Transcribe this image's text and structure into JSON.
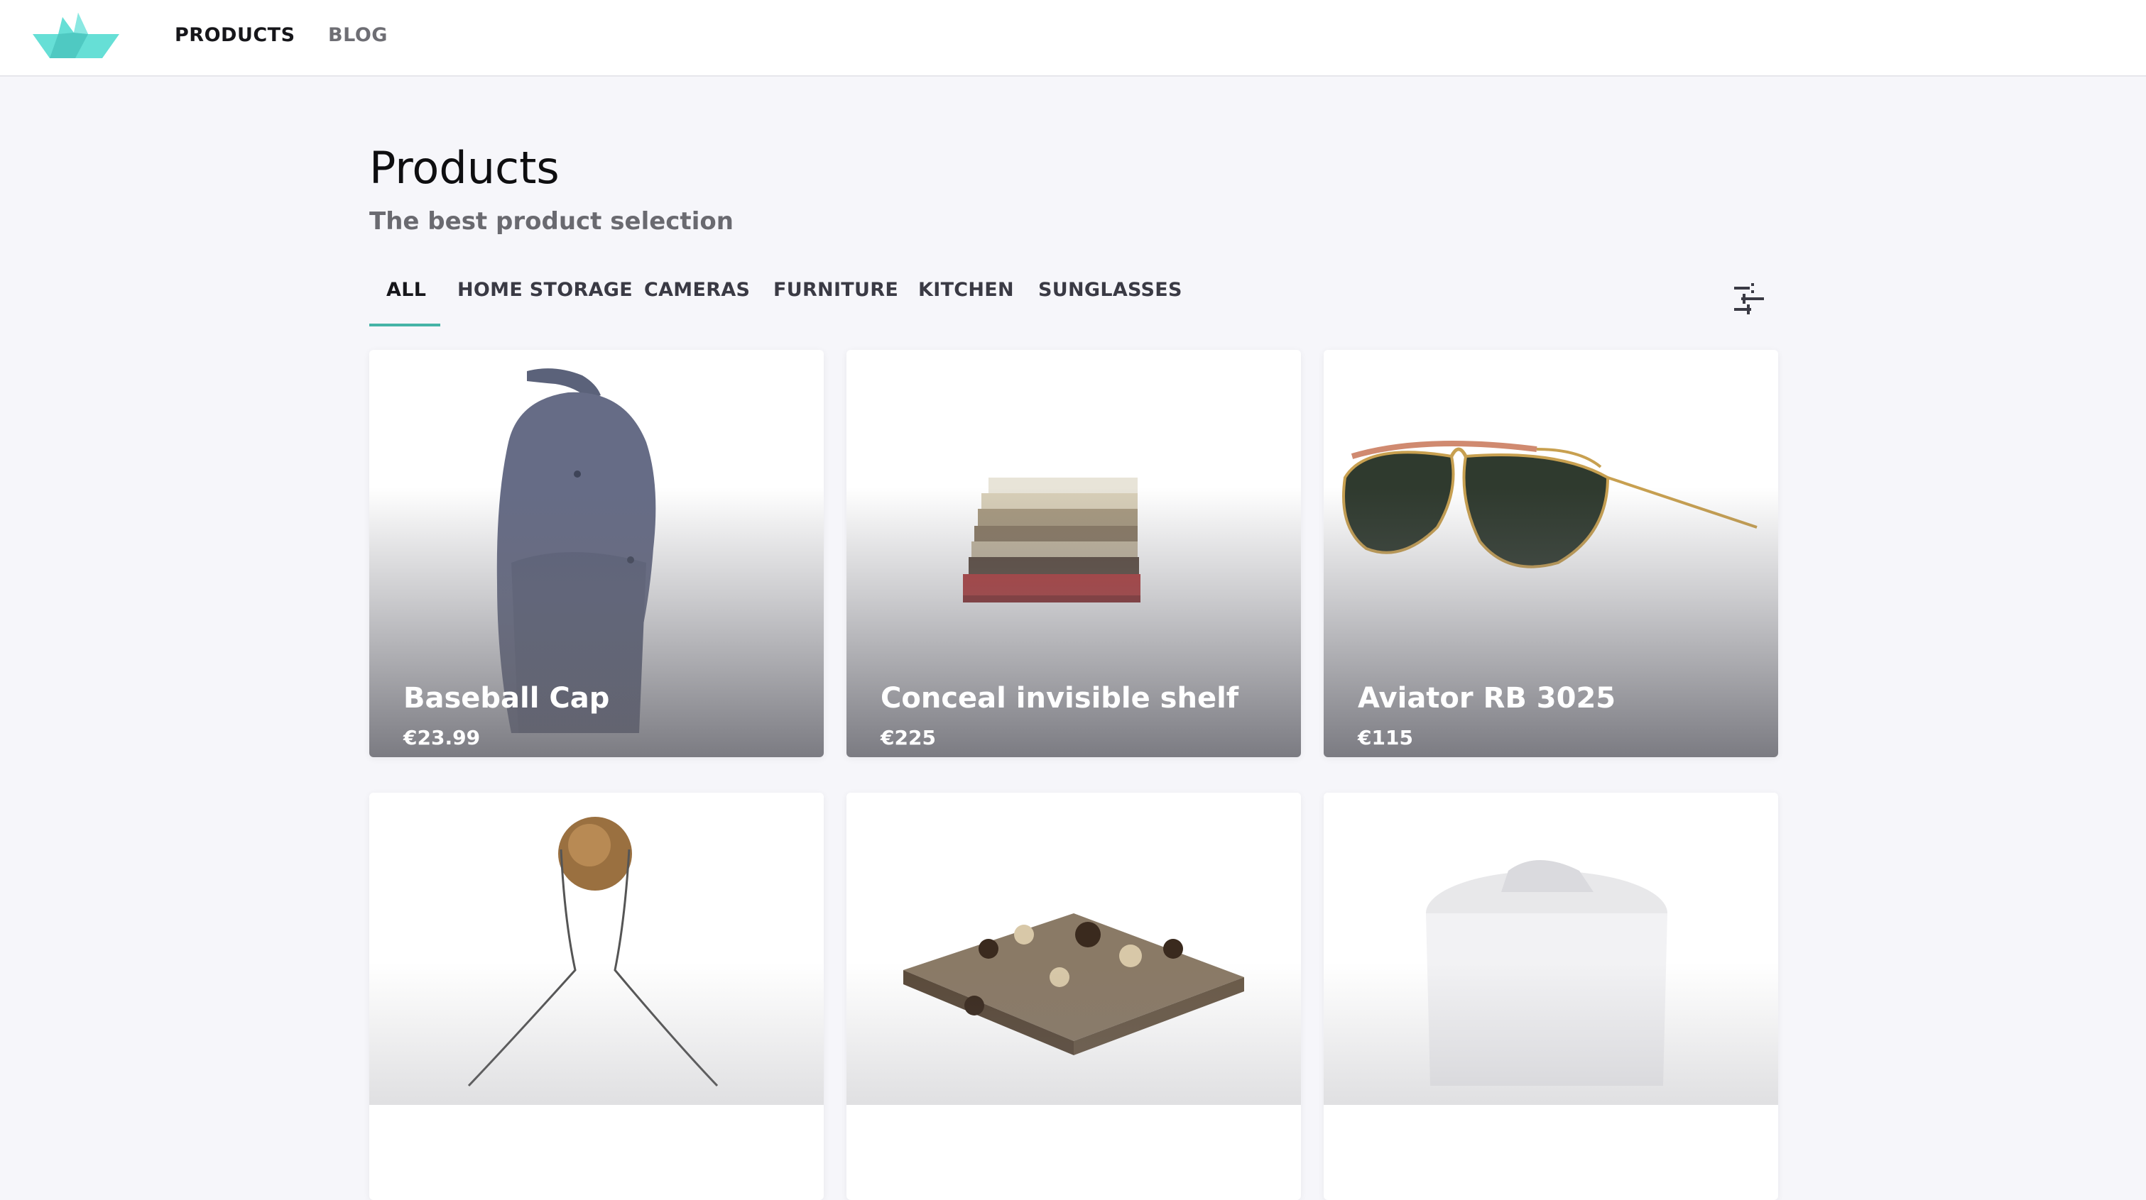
{
  "header": {
    "logo_icon": "paper-boat-icon",
    "nav": [
      {
        "label": "PRODUCTS",
        "active": true
      },
      {
        "label": "BLOG",
        "active": false
      }
    ]
  },
  "main": {
    "title": "Products",
    "subtitle": "The best product selection",
    "tabs": [
      "ALL",
      "HOME STORAGE",
      "CAMERAS",
      "FURNITURE",
      "KITCHEN",
      "SUNGLASSES"
    ],
    "active_tab": "ALL",
    "filter_icon": "sliders-icon",
    "products": [
      {
        "name": "Baseball Cap",
        "price": "€23.99",
        "image": "baseball-cap-image"
      },
      {
        "name": "Conceal invisible shelf",
        "price": "€225",
        "image": "book-stack-shelf-image"
      },
      {
        "name": "Aviator RB 3025",
        "price": "€115",
        "image": "aviator-sunglasses-image"
      },
      {
        "name": "",
        "price": "",
        "image": "glass-carafe-image"
      },
      {
        "name": "",
        "price": "",
        "image": "chess-set-image"
      },
      {
        "name": "",
        "price": "",
        "image": "ceramic-jar-image"
      }
    ]
  },
  "colors": {
    "accent": "#45b3a6",
    "background": "#f6f6fa",
    "logo": "#5fd9d2"
  }
}
